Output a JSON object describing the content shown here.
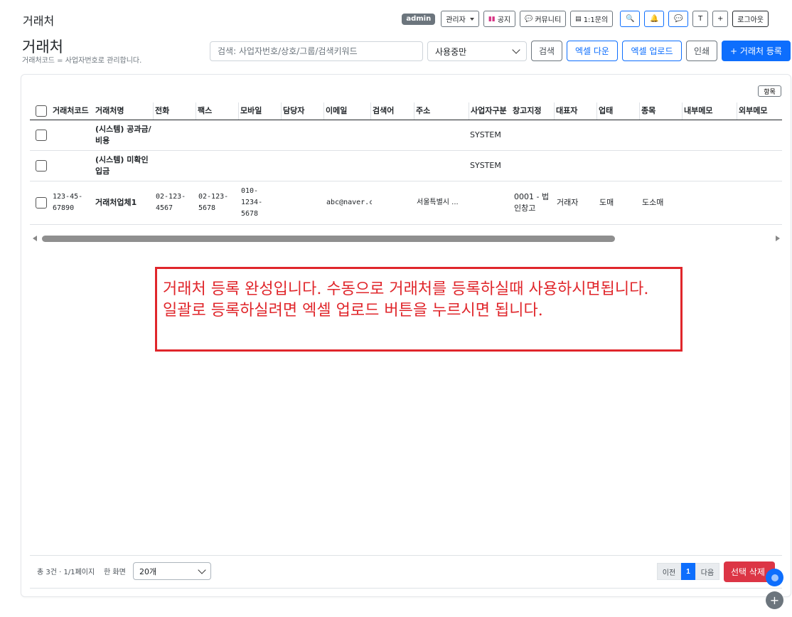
{
  "topbar": {
    "brand": "거래처",
    "admin_badge": "admin",
    "role_label": "관리자",
    "notice_label": "공지",
    "community_label": "커뮤니티",
    "inquiry_label": "1:1문의",
    "font_label": "T",
    "plus_label": "+",
    "logout_label": "로그아웃"
  },
  "header": {
    "title": "거래처",
    "subtitle": "거래처코드 = 사업자번호로 관리합니다.",
    "search_placeholder": "검색: 사업자번호/상호/그룹/검색키워드",
    "status_value": "사용중만",
    "search_btn": "검색",
    "excel_download_btn": "엑셀 다운",
    "excel_upload_btn": "엑셀 업로드",
    "print_btn": "인쇄",
    "add_btn": "+ 거래처 등록"
  },
  "table": {
    "columns_btn": "항목",
    "headers": [
      "거래처코드",
      "거래처명",
      "전화",
      "팩스",
      "모바일",
      "담당자",
      "이메일",
      "검색어",
      "주소",
      "사업자구분",
      "창고지정",
      "대표자",
      "업태",
      "종목",
      "내부메모",
      "외부메모"
    ],
    "rows": [
      {
        "code": "",
        "name": "(시스템) 공과금/비용",
        "tel": "",
        "fax": "",
        "mobile": "",
        "manager": "",
        "email": "",
        "keyword": "",
        "address": "",
        "biztype": "SYSTEM",
        "warehouse": "",
        "ceo": "",
        "category": "",
        "item": "",
        "memo_in": "",
        "memo_out": ""
      },
      {
        "code": "",
        "name": "(시스템) 미확인입금",
        "tel": "",
        "fax": "",
        "mobile": "",
        "manager": "",
        "email": "",
        "keyword": "",
        "address": "",
        "biztype": "SYSTEM",
        "warehouse": "",
        "ceo": "",
        "category": "",
        "item": "",
        "memo_in": "",
        "memo_out": ""
      },
      {
        "code": "123-45-67890",
        "name": "거래처업체1",
        "tel": "02-123-4567",
        "fax": "02-123-5678",
        "mobile": "010-1234-5678",
        "manager": "",
        "email": "abc@naver.com",
        "keyword": "",
        "address": "서울특별시 ...",
        "biztype": "",
        "warehouse": "0001 - 법인창고",
        "ceo": "거래자",
        "category": "도매",
        "item": "도소매",
        "memo_in": "",
        "memo_out": ""
      }
    ]
  },
  "annotation": {
    "line1": "거래처 등록 완성입니다. 수동으로 거래처를 등록하실때 사용하시면됩니다.",
    "line2": "일괄로 등록하실려면 엑셀 업로드 버튼을 누르시면 됩니다."
  },
  "footer": {
    "total": "총 3건 · 1/1페이지",
    "perpage_label": "한 화면",
    "perpage_value": "20개",
    "prev": "이전",
    "page": "1",
    "next": "다음",
    "delete_btn": "선택 삭제"
  },
  "colors": {
    "primary": "#0d6efd",
    "danger": "#dc3545",
    "annotation": "#e0262b"
  }
}
